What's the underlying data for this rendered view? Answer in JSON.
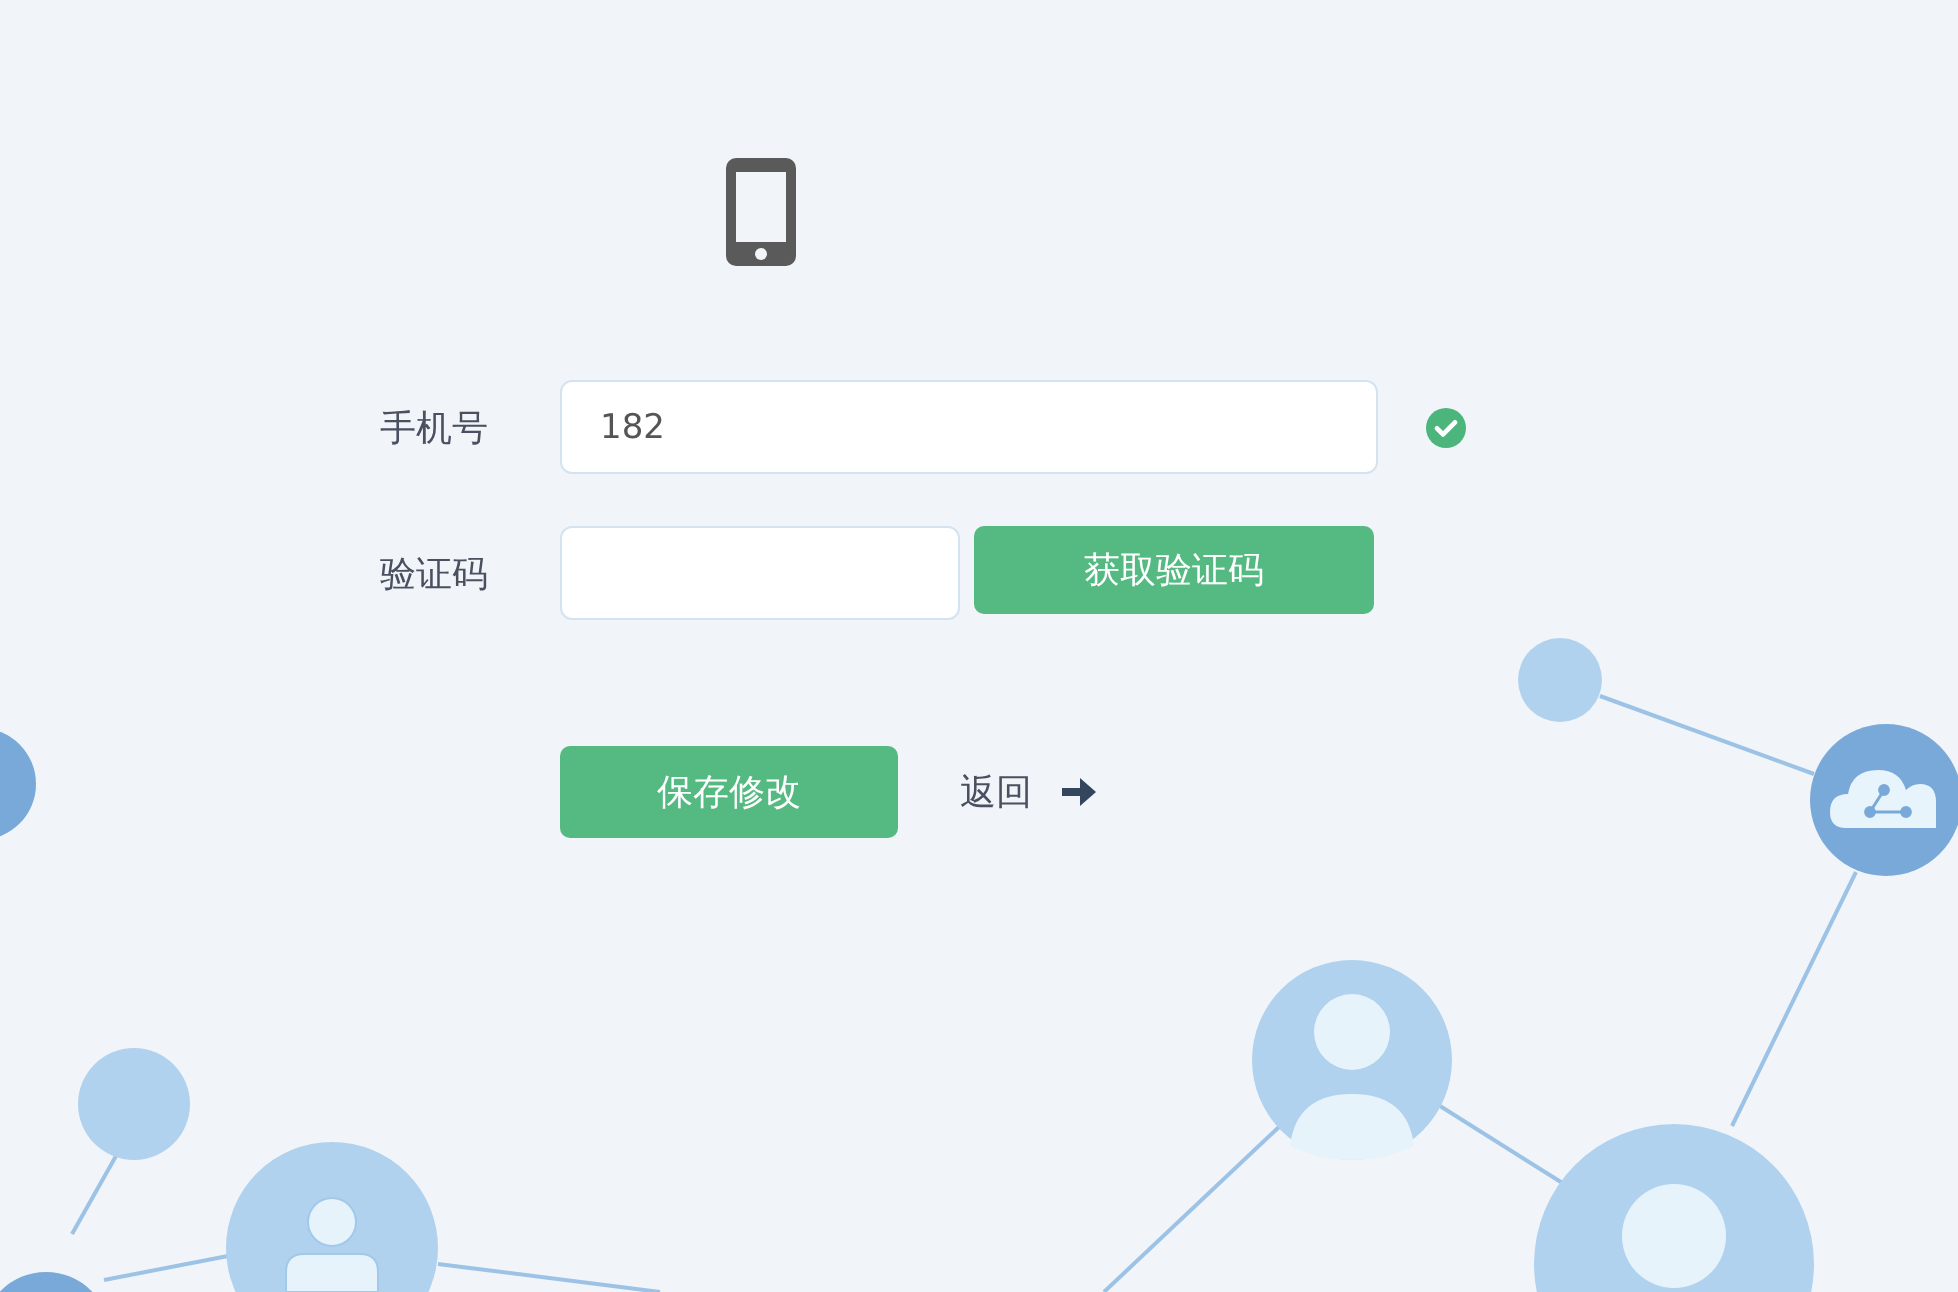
{
  "form": {
    "fields": [
      {
        "kind": "phone",
        "label": "手机号",
        "value": "182",
        "valid": true
      },
      {
        "kind": "code",
        "label": "验证码",
        "button": "获取验证码"
      }
    ]
  },
  "actions": {
    "save": "保存修改",
    "back": "返回"
  }
}
